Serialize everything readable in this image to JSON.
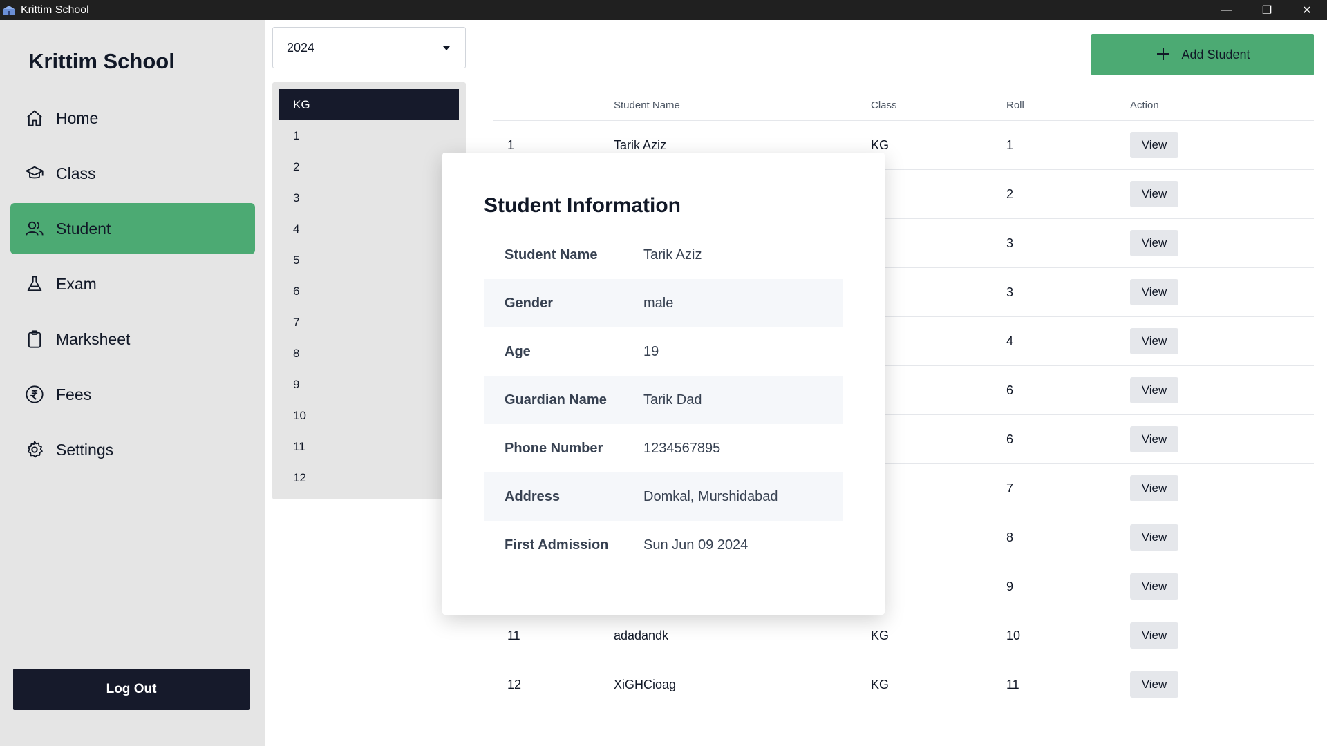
{
  "window": {
    "title": "Krittim School",
    "controls": [
      "—",
      "❐",
      "✕"
    ]
  },
  "sidebar": {
    "brand": "Krittim School",
    "items": [
      {
        "label": "Home",
        "icon": "home-icon",
        "active": false
      },
      {
        "label": "Class",
        "icon": "graduation-cap-icon",
        "active": false
      },
      {
        "label": "Student",
        "icon": "users-icon",
        "active": true
      },
      {
        "label": "Exam",
        "icon": "flask-icon",
        "active": false
      },
      {
        "label": "Marksheet",
        "icon": "clipboard-icon",
        "active": false
      },
      {
        "label": "Fees",
        "icon": "rupee-icon",
        "active": false
      },
      {
        "label": "Settings",
        "icon": "gear-icon",
        "active": false
      }
    ],
    "logout_label": "Log Out",
    "active_color": "#4caa73"
  },
  "year_select": {
    "value": "2024"
  },
  "class_list": [
    "KG",
    "1",
    "2",
    "3",
    "4",
    "5",
    "6",
    "7",
    "8",
    "9",
    "10",
    "11",
    "12"
  ],
  "class_list_active": "KG",
  "add_button": {
    "label": "Add Student",
    "icon": "plus-icon"
  },
  "table": {
    "headers": [
      "",
      "Student Name",
      "Class",
      "Roll",
      "Action"
    ],
    "rows": [
      {
        "no": "1",
        "name": "Tarik Aziz",
        "class": "KG",
        "roll": "1",
        "action": "View"
      },
      {
        "no": "",
        "name": "",
        "class": "",
        "roll": "2",
        "action": "View"
      },
      {
        "no": "",
        "name": "",
        "class": "",
        "roll": "3",
        "action": "View"
      },
      {
        "no": "",
        "name": "",
        "class": "",
        "roll": "3",
        "action": "View"
      },
      {
        "no": "",
        "name": "",
        "class": "",
        "roll": "4",
        "action": "View"
      },
      {
        "no": "",
        "name": "",
        "class": "",
        "roll": "6",
        "action": "View"
      },
      {
        "no": "",
        "name": "",
        "class": "",
        "roll": "6",
        "action": "View"
      },
      {
        "no": "",
        "name": "",
        "class": "",
        "roll": "7",
        "action": "View"
      },
      {
        "no": "",
        "name": "",
        "class": "",
        "roll": "8",
        "action": "View"
      },
      {
        "no": "",
        "name": "",
        "class": "",
        "roll": "9",
        "action": "View"
      },
      {
        "no": "11",
        "name": "adadandk",
        "class": "KG",
        "roll": "10",
        "action": "View"
      },
      {
        "no": "12",
        "name": "XiGHCioag",
        "class": "KG",
        "roll": "11",
        "action": "View"
      }
    ]
  },
  "modal": {
    "title": "Student Information",
    "fields": [
      {
        "label": "Student Name",
        "value": "Tarik Aziz"
      },
      {
        "label": "Gender",
        "value": "male"
      },
      {
        "label": "Age",
        "value": "19"
      },
      {
        "label": "Guardian Name",
        "value": "Tarik Dad"
      },
      {
        "label": "Phone Number",
        "value": "1234567895"
      },
      {
        "label": "Address",
        "value": "Domkal, Murshidabad"
      },
      {
        "label": "First Admission",
        "value": "Sun Jun 09 2024"
      }
    ]
  }
}
